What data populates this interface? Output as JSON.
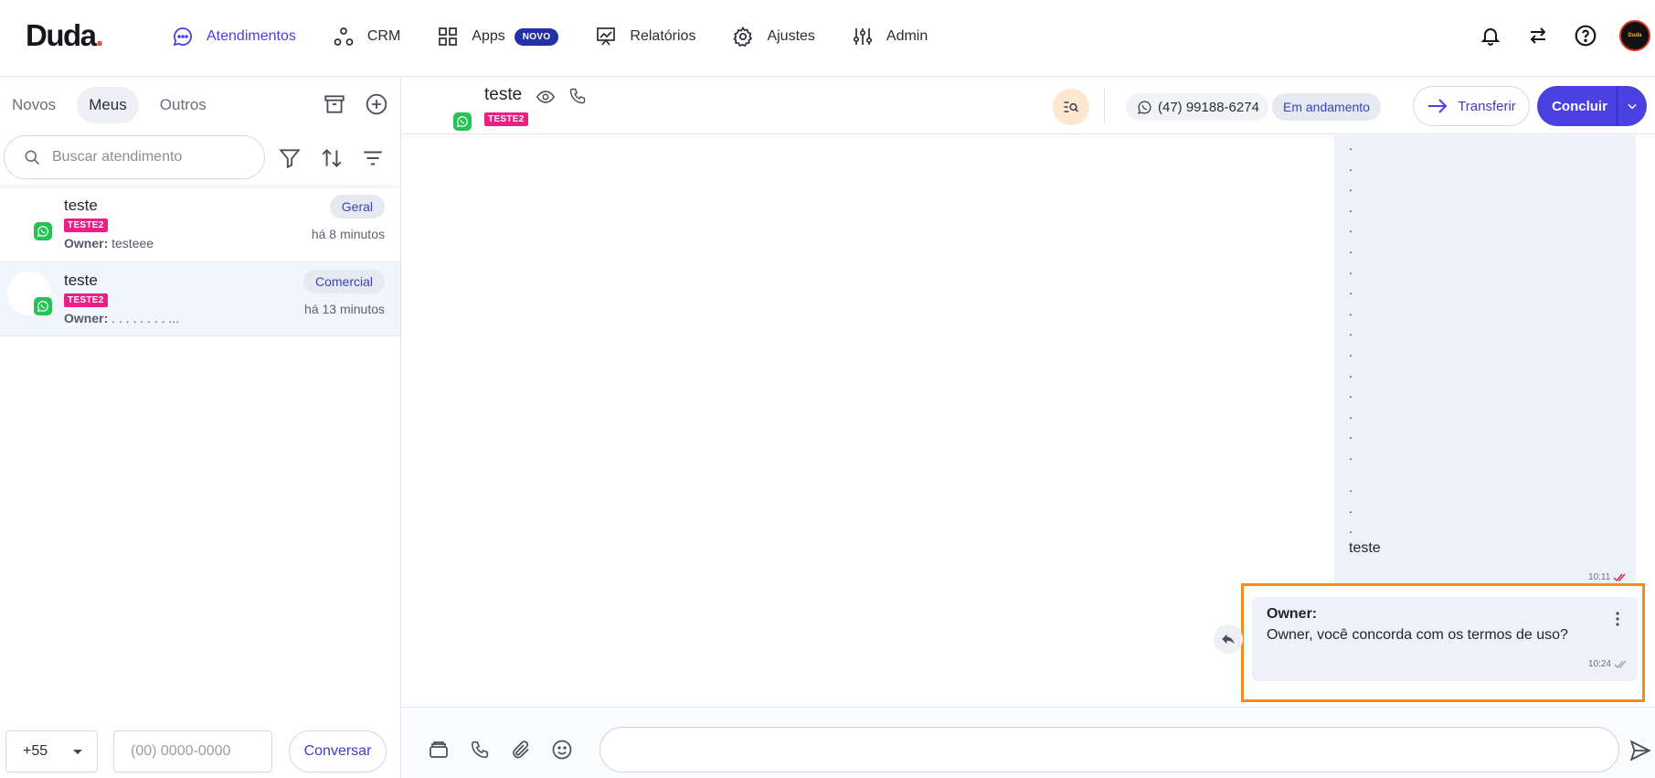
{
  "brand": {
    "logo": "Duda",
    "logo_dot": "."
  },
  "nav": {
    "items": [
      {
        "label": "Atendimentos",
        "icon": "chat-bubble-icon",
        "active": true
      },
      {
        "label": "CRM",
        "icon": "nodes-icon"
      },
      {
        "label": "Apps",
        "icon": "grid-icon",
        "badge": "NOVO"
      },
      {
        "label": "Relatórios",
        "icon": "presentation-chart-icon"
      },
      {
        "label": "Ajustes",
        "icon": "gear-icon"
      },
      {
        "label": "Admin",
        "icon": "sliders-icon"
      }
    ]
  },
  "topbar_icons": [
    "bell-icon",
    "swap-arrows-icon",
    "help-icon",
    "user-avatar"
  ],
  "sidebar": {
    "tabs": [
      {
        "label": "Novos"
      },
      {
        "label": "Meus",
        "active": true
      },
      {
        "label": "Outros"
      }
    ],
    "search_placeholder": "Buscar atendimento",
    "conversations": [
      {
        "name": "teste",
        "tag": "TESTE2",
        "owner_label": "Owner:",
        "owner_value": "testeee",
        "department": "Geral",
        "time": "há 8 minutos",
        "selected": false
      },
      {
        "name": "teste",
        "tag": "TESTE2",
        "owner_label": "Owner:",
        "owner_value": ". . . . . . . . ...",
        "department": "Comercial",
        "time": "há 13 minutos",
        "selected": true
      }
    ],
    "bottom": {
      "ddi": "+55",
      "phone_placeholder": "(00) 0000-0000",
      "button": "Conversar"
    }
  },
  "chat": {
    "contact_name": "teste",
    "tag": "TESTE2",
    "phone": "(47) 99188-6274",
    "status": "Em andamento",
    "transfer_label": "Transferir",
    "conclude_label": "Concluir",
    "messages": {
      "outgoing": {
        "dots_top": ".\n.\n.\n.\n.\n.\n.\n.\n.\n.\n.\n.\n.\n.\n.\n.",
        "dots_bottom": ".\n.\n.",
        "text": "teste",
        "time": "10:11"
      },
      "incoming": {
        "owner": "Owner:",
        "text": "Owner, você concorda com os termos de uso?",
        "time": "10:24"
      }
    },
    "composer_placeholder": ""
  },
  "colors": {
    "accent": "#4b40e0",
    "highlight": "#f28c1b",
    "tag_pink": "#ec1f86",
    "whatsapp": "#25c254"
  }
}
